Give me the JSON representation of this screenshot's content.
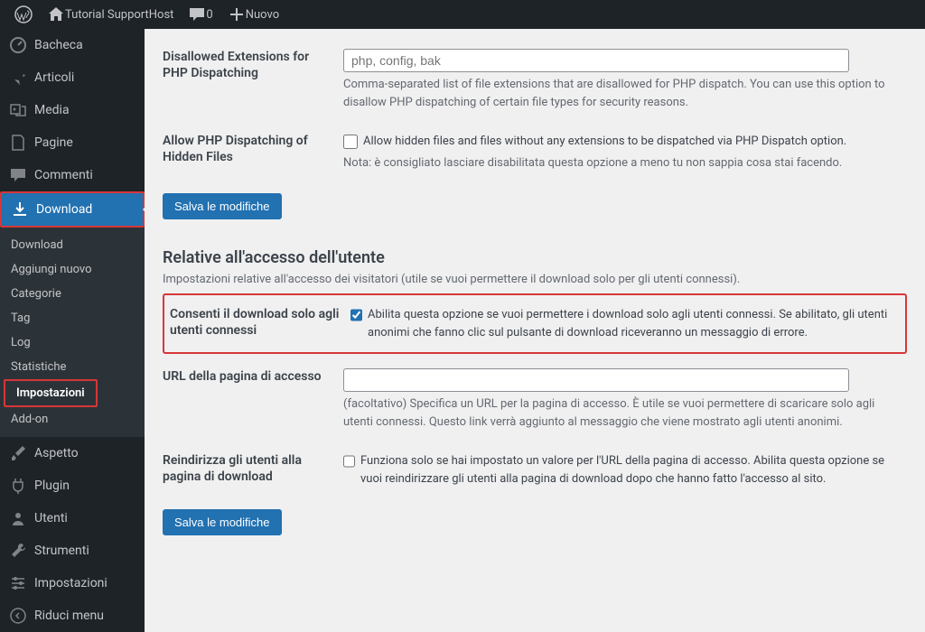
{
  "topbar": {
    "site_name": "Tutorial SupportHost",
    "comments_count": "0",
    "new_label": "Nuovo"
  },
  "sidebar": {
    "dashboard": "Bacheca",
    "posts": "Articoli",
    "media": "Media",
    "pages": "Pagine",
    "comments": "Commenti",
    "download": "Download",
    "sub_download": "Download",
    "sub_addnew": "Aggiungi nuovo",
    "sub_categories": "Categorie",
    "sub_tag": "Tag",
    "sub_log": "Log",
    "sub_stats": "Statistiche",
    "sub_settings": "Impostazioni",
    "sub_addon": "Add-on",
    "appearance": "Aspetto",
    "plugins": "Plugin",
    "users": "Utenti",
    "tools": "Strumenti",
    "settings": "Impostazioni",
    "collapse": "Riduci menu"
  },
  "form": {
    "disallowed_label": "Disallowed Extensions for PHP Dispatching",
    "disallowed_placeholder": "php, config, bak",
    "disallowed_desc": "Comma-separated list of file extensions that are disallowed for PHP dispatch. You can use this option to disallow PHP dispatching of certain file types for security reasons.",
    "hidden_label": "Allow PHP Dispatching of Hidden Files",
    "hidden_check": "Allow hidden files and files without any extensions to be dispatched via PHP Dispatch option.",
    "hidden_note": "Nota: è consigliato lasciare disabilitata questa opzione a meno tu non sappia cosa stai facendo.",
    "save": "Salva le modifiche",
    "section_title": "Relative all'accesso dell'utente",
    "section_desc": "Impostazioni relative all'accesso dei visitatori (utile se vuoi permettere il download solo per gli utenti connessi).",
    "only_logged_label": "Consenti il download solo agli utenti connessi",
    "only_logged_check": "Abilita questa opzione se vuoi permettere i download solo agli utenti connessi. Se abilitato, gli utenti anonimi che fanno clic sul pulsante di download riceveranno un messaggio di errore.",
    "login_url_label": "URL della pagina di accesso",
    "login_url_desc": "(facoltativo) Specifica un URL per la pagina di accesso. È utile se vuoi permettere di scaricare solo agli utenti connessi. Questo link verrà aggiunto al messaggio che viene mostrato agli utenti anonimi.",
    "redirect_label": "Reindirizza gli utenti alla pagina di download",
    "redirect_check": "Funziona solo se hai impostato un valore per l'URL della pagina di accesso. Abilita questa opzione se vuoi reindirizzare gli utenti alla pagina di download dopo che hanno fatto l'accesso al sito."
  }
}
